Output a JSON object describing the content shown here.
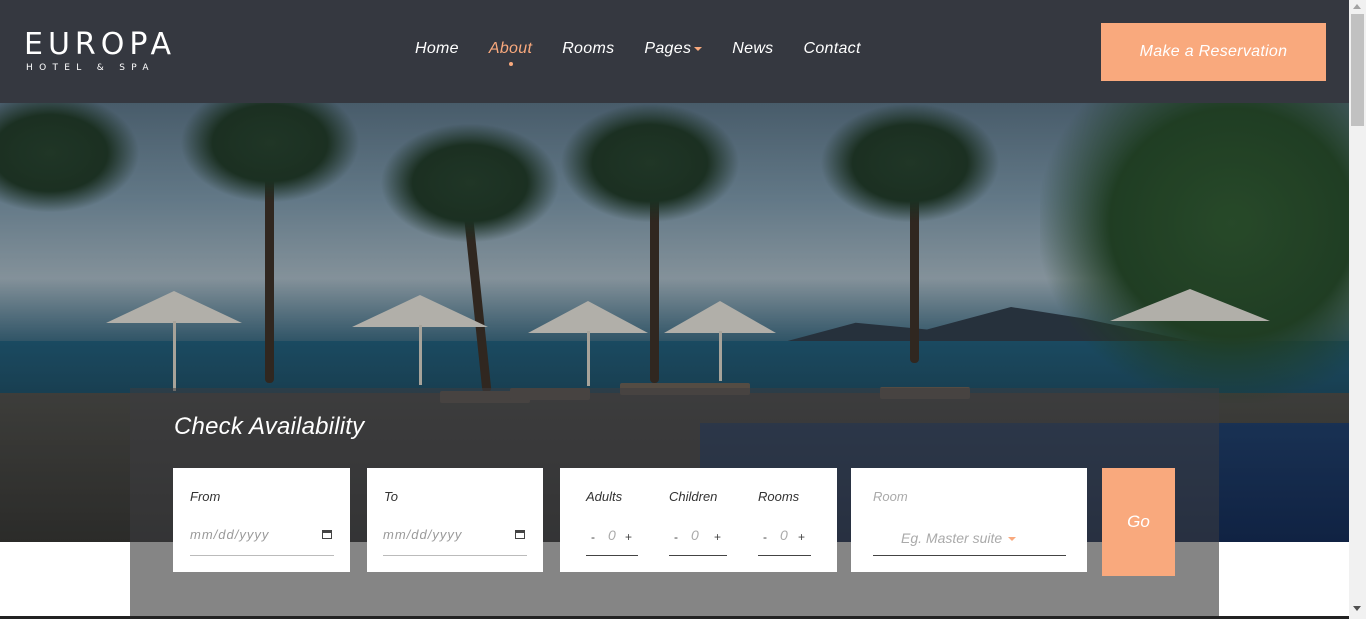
{
  "brand": {
    "title": "EUROPA",
    "subtitle": "HOTEL & SPA"
  },
  "nav": {
    "items": [
      {
        "label": "Home",
        "active": false
      },
      {
        "label": "About",
        "active": true
      },
      {
        "label": "Rooms",
        "active": false
      },
      {
        "label": "Pages",
        "active": false,
        "has_dropdown": true
      },
      {
        "label": "News",
        "active": false
      },
      {
        "label": "Contact",
        "active": false
      }
    ],
    "reserve_label": "Make a Reservation"
  },
  "booking": {
    "title": "Check Availability",
    "from": {
      "label": "From",
      "placeholder": "mm/dd/yyyy"
    },
    "to": {
      "label": "To",
      "placeholder": "mm/dd/yyyy"
    },
    "adults": {
      "label": "Adults",
      "value": "0",
      "minus": "-",
      "plus": "+"
    },
    "children": {
      "label": "Children",
      "value": "0",
      "minus": "-",
      "plus": "+"
    },
    "rooms": {
      "label": "Rooms",
      "value": "0",
      "minus": "-",
      "plus": "+"
    },
    "room": {
      "label": "Room",
      "placeholder": "Eg. Master suite"
    },
    "go_label": "Go"
  },
  "colors": {
    "accent": "#f9a97d",
    "header_bg": "#353840"
  },
  "icons": {
    "calendar": "calendar-icon",
    "dropdown": "chevron-down-icon"
  }
}
